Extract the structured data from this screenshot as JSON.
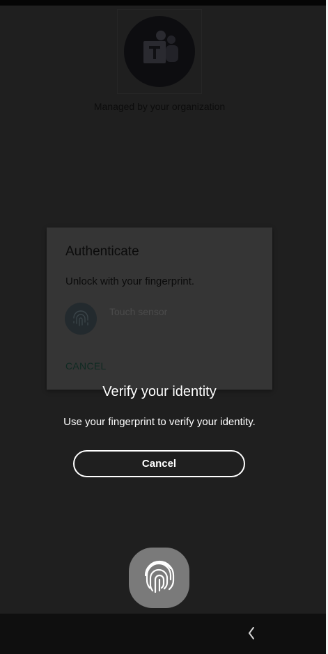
{
  "background_app": {
    "logo_icon": "teams-logo-icon",
    "managed_text": "Managed by your organization"
  },
  "auth_dialog": {
    "title": "Authenticate",
    "subtitle": "Unlock with your fingerprint.",
    "fingerprint_icon": "fingerprint-icon",
    "touch_sensor_label": "Touch sensor",
    "cancel_label": "CANCEL"
  },
  "biometric_prompt": {
    "title": "Verify your identity",
    "description": "Use your fingerprint to verify your identity.",
    "cancel_label": "Cancel",
    "sensor_icon": "fingerprint-icon"
  },
  "nav_bar": {
    "back_icon": "back-chevron-icon"
  },
  "colors": {
    "background": "#1f1f1f",
    "prompt_text": "#ffffff",
    "sensor": "#7a7a7a",
    "accent_dim": "#0f2a22"
  }
}
